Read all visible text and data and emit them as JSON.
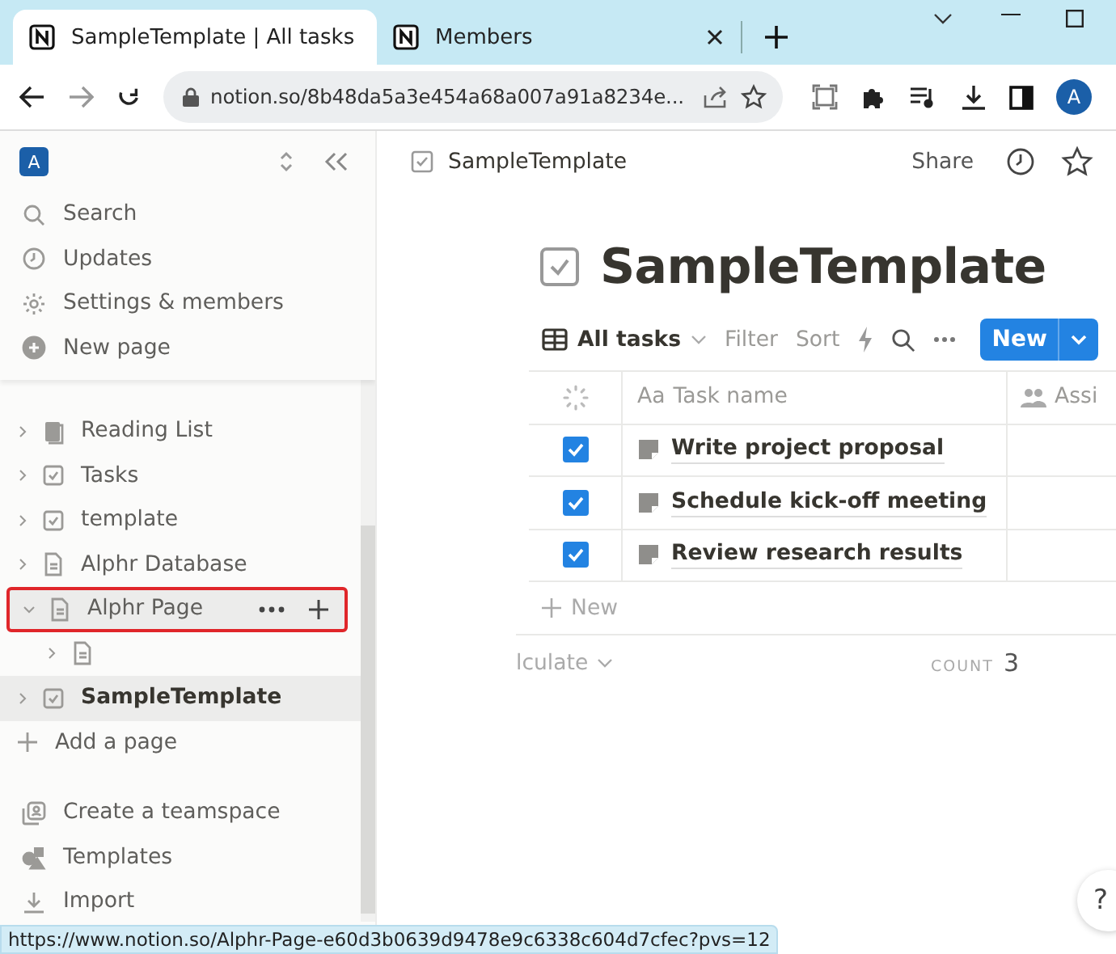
{
  "browser": {
    "tabs": [
      {
        "title": "SampleTemplate | All tasks",
        "selected": true
      },
      {
        "title": "Members",
        "selected": false
      }
    ],
    "address": "notion.so/8b48da5a3e454a68a007a91a8234e...",
    "profile_initial": "A"
  },
  "sidebar": {
    "workspace_initial": "A",
    "menu": [
      {
        "label": "Search"
      },
      {
        "label": "Updates"
      },
      {
        "label": "Settings & members"
      },
      {
        "label": "New page"
      }
    ],
    "pages": [
      {
        "label": "Reading List",
        "kind": "book",
        "expanded": false,
        "selected": false,
        "highlighted": false
      },
      {
        "label": "Tasks",
        "kind": "database",
        "expanded": false,
        "selected": false,
        "highlighted": false
      },
      {
        "label": "template",
        "kind": "database",
        "expanded": false,
        "selected": false,
        "highlighted": false
      },
      {
        "label": "Alphr Database",
        "kind": "page",
        "expanded": false,
        "selected": false,
        "highlighted": false
      },
      {
        "label": "Alphr Page",
        "kind": "page",
        "expanded": true,
        "selected": false,
        "highlighted": true,
        "children": [
          {
            "kind": "page",
            "expanded": false,
            "selected": false,
            "highlighted": false
          }
        ]
      },
      {
        "label": "SampleTemplate",
        "kind": "database",
        "expanded": false,
        "selected": true,
        "highlighted": false
      }
    ],
    "add_page": "Add a page",
    "footer": [
      {
        "label": "Create a teamspace"
      },
      {
        "label": "Templates"
      },
      {
        "label": "Import"
      }
    ]
  },
  "topbar": {
    "breadcrumb": "SampleTemplate",
    "share": "Share"
  },
  "page": {
    "title": "SampleTemplate",
    "view": "All tasks",
    "toolbar": [
      "Filter",
      "Sort"
    ],
    "new_button": "New",
    "table": {
      "columns": [
        {
          "prefix": "Aa",
          "label": "Task name"
        },
        {
          "label": "Assi"
        }
      ],
      "rows": [
        {
          "done": true,
          "name": "Write project proposal"
        },
        {
          "done": true,
          "name": "Schedule kick-off meeting"
        },
        {
          "done": true,
          "name": "Review research results"
        }
      ],
      "new_row": "New",
      "calculate": "lculate",
      "count_label": "COUNT",
      "count": "3"
    }
  },
  "help": "?",
  "status_url": "https://www.notion.so/Alphr-Page-e60d3b0639d9478e9c6338c604d7cfec?pvs=12"
}
